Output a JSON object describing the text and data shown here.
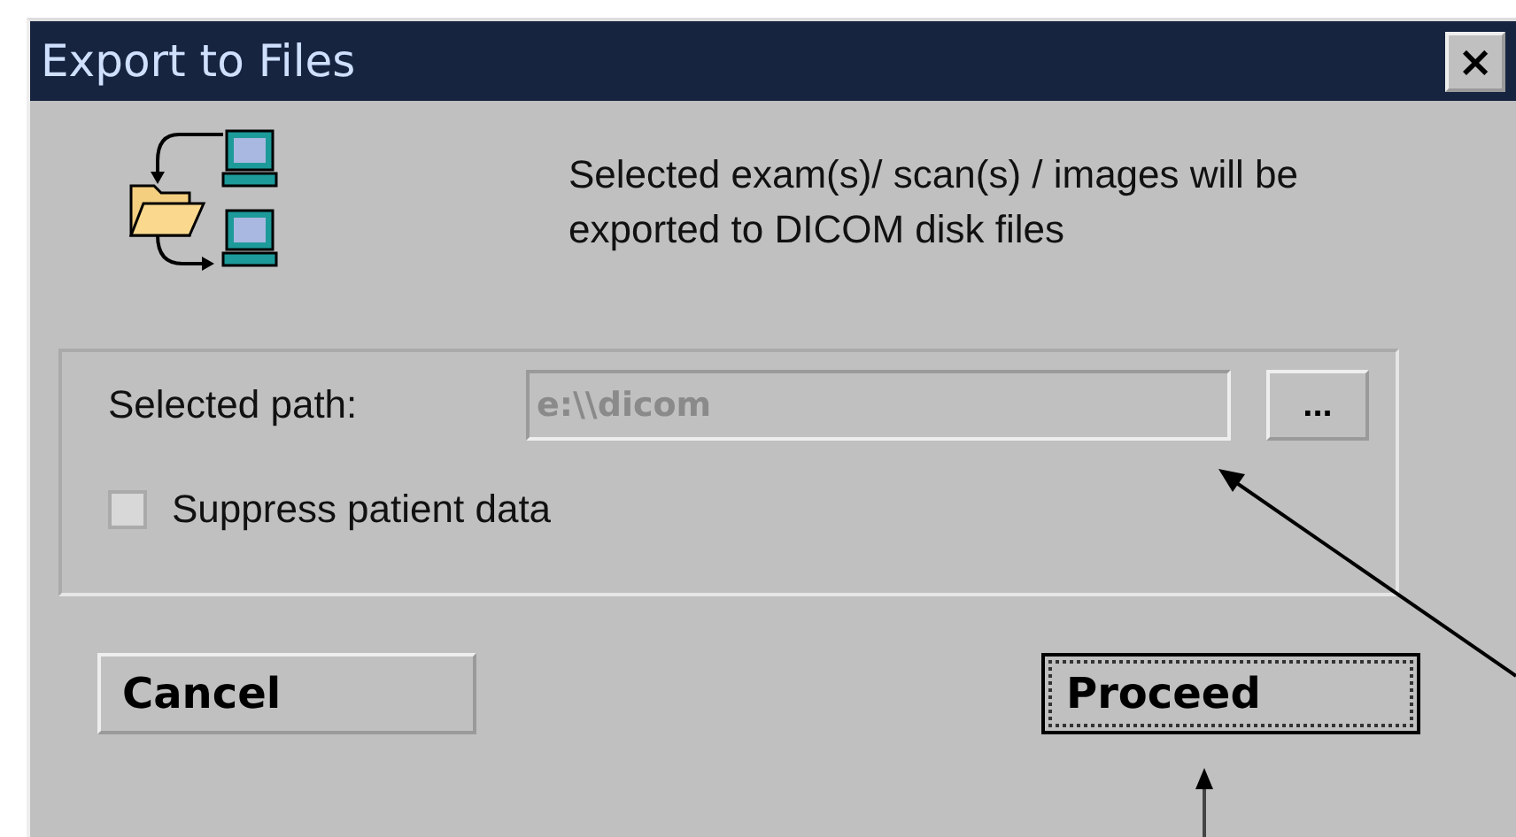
{
  "window": {
    "title": "Export to Files",
    "close": "×"
  },
  "description": "Selected exam(s)/ scan(s) / images will be exported to DICOM disk files",
  "path": {
    "label": "Selected path:",
    "value": "e:\\\\dicom",
    "disabled": true,
    "browse": "..."
  },
  "suppress": {
    "label": "Suppress patient data",
    "checked": false
  },
  "buttons": [
    {
      "label": "Cancel",
      "focused": false
    },
    {
      "label": "Proceed",
      "focused": true
    }
  ]
}
